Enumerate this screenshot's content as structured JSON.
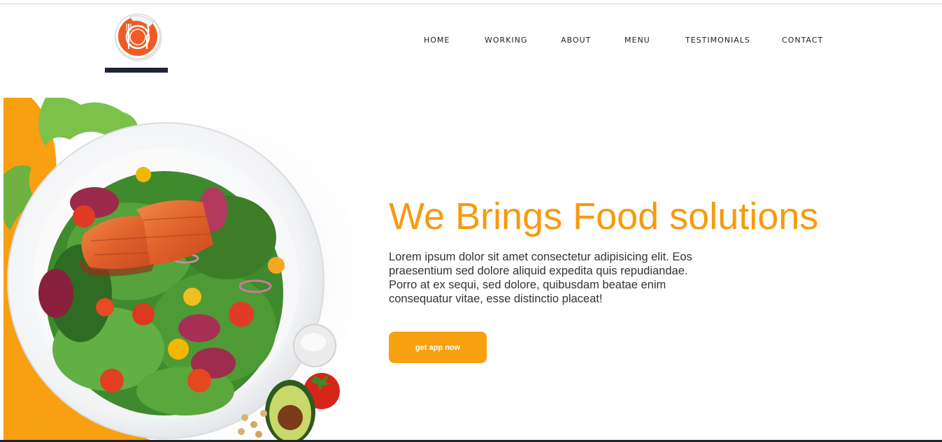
{
  "header": {
    "logo_icon": "plate-fork-knife-icon",
    "nav": [
      {
        "label": "HOME"
      },
      {
        "label": "WORKING"
      },
      {
        "label": "ABOUT"
      },
      {
        "label": "MENU"
      },
      {
        "label": "TESTIMONIALS"
      },
      {
        "label": "CONTACT"
      }
    ]
  },
  "hero": {
    "title": "We Brings Food solutions",
    "text": "Lorem ipsum dolor sit amet consectetur adipisicing elit. Eos praesentium sed dolore aliquid expedita quis repudiandae. Porro at ex sequi, sed dolore, quibusdam beatae enim consequatur vitae, esse distinctio placeat!",
    "cta_label": "get app now",
    "image": "salmon-salad-plate-image"
  },
  "colors": {
    "accent": "#f79a0e",
    "button": "#f8a00f",
    "logo_orange": "#f25a24",
    "text": "#333333"
  }
}
